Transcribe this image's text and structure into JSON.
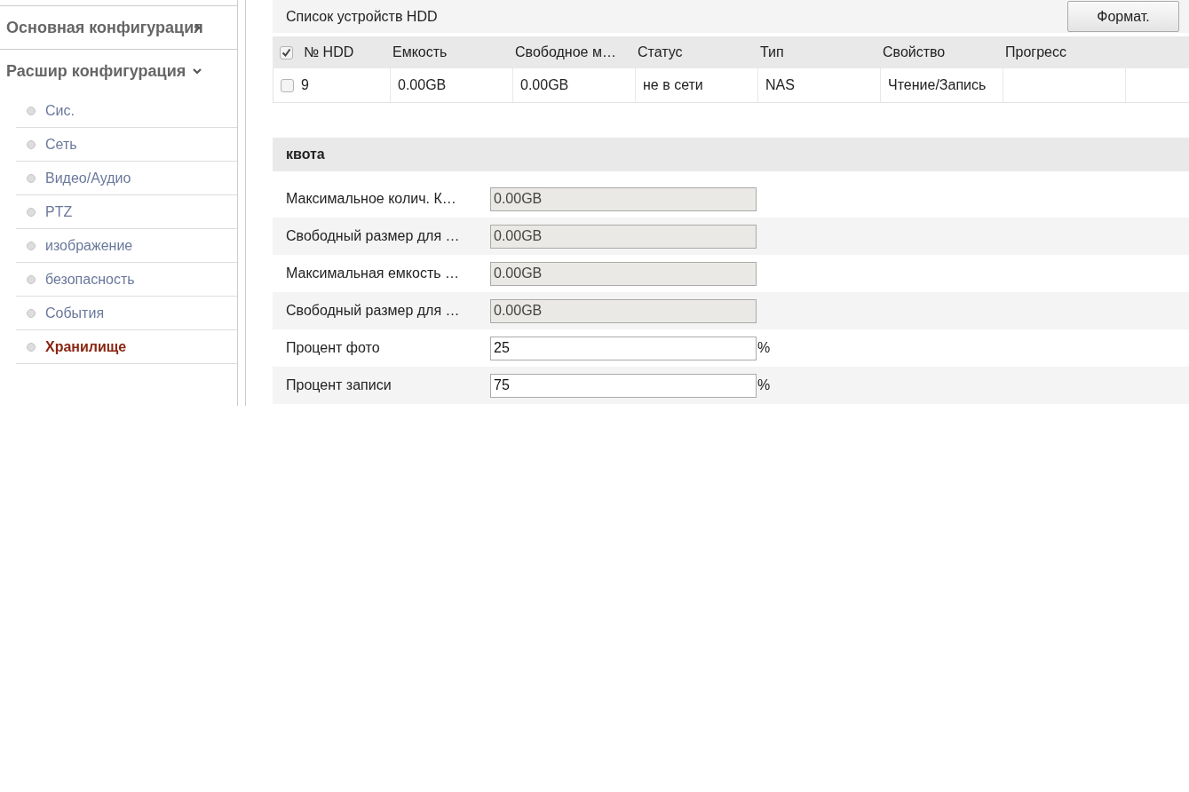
{
  "sidebar": {
    "sections": [
      {
        "label": "Основная конфигурация",
        "expanded": false
      },
      {
        "label": "Расшир конфигурация",
        "expanded": true,
        "items": [
          {
            "label": "Сис.",
            "selected": false
          },
          {
            "label": "Сеть",
            "selected": false
          },
          {
            "label": "Видео/Аудио",
            "selected": false
          },
          {
            "label": "PTZ",
            "selected": false
          },
          {
            "label": "изображение",
            "selected": false
          },
          {
            "label": "безопасность",
            "selected": false
          },
          {
            "label": "События",
            "selected": false
          },
          {
            "label": "Хранилище",
            "selected": true
          }
        ]
      }
    ]
  },
  "hdd_list": {
    "title": "Список устройств HDD",
    "format_button": "Формат.",
    "select_all_checked": true,
    "columns": [
      "№ HDD",
      "Емкость",
      "Свободное м…",
      "Статус",
      "Тип",
      "Свойство",
      "Прогресс"
    ],
    "rows": [
      {
        "checked": false,
        "cells": [
          "9",
          "0.00GB",
          "0.00GB",
          "не в сети",
          "NAS",
          "Чтение/Запись"
        ]
      }
    ]
  },
  "quota": {
    "title": "квота",
    "fields": [
      {
        "label": "Максимальное колич. К…",
        "value": "0.00GB",
        "disabled": true
      },
      {
        "label": "Свободный размер для …",
        "value": "0.00GB",
        "disabled": true
      },
      {
        "label": "Максимальная емкость …",
        "value": "0.00GB",
        "disabled": true
      },
      {
        "label": "Свободный размер для …",
        "value": "0.00GB",
        "disabled": true
      },
      {
        "label": "Процент фото",
        "value": "25",
        "disabled": false,
        "unit": "%"
      },
      {
        "label": "Процент записи",
        "value": "75",
        "disabled": false,
        "unit": "%"
      }
    ]
  }
}
